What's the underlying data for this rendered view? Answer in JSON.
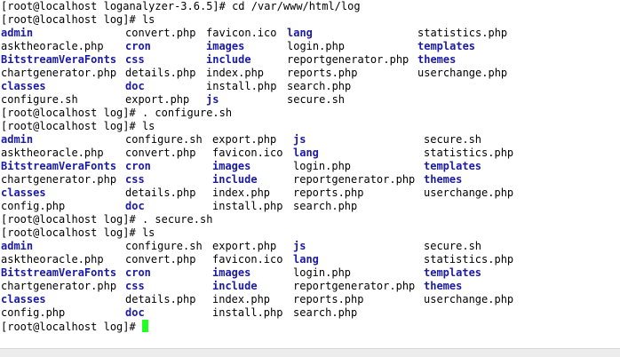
{
  "colors": {
    "background": "#ffffff",
    "text": "#000000",
    "directory": "#1a1aa6",
    "cursor": "#22ff22"
  },
  "lines": {
    "l0": "[root@localhost loganalyzer-3.6.5]# cd /var/www/html/log",
    "l1": "[root@localhost log]# ls",
    "l7": "[root@localhost log]# . configure.sh",
    "l8": "[root@localhost log]# ls",
    "l14": "[root@localhost log]# . secure.sh",
    "l15": "[root@localhost log]# ls",
    "l21": "[root@localhost log]# "
  },
  "ls1": {
    "r1": [
      "admin",
      "convert.php",
      "favicon.ico",
      "lang",
      "statistics.php"
    ],
    "r2": [
      "asktheoracle.php",
      "cron",
      "images",
      "login.php",
      "templates"
    ],
    "r3": [
      "BitstreamVeraFonts",
      "css",
      "include",
      "reportgenerator.php",
      "themes"
    ],
    "r4": [
      "chartgenerator.php",
      "details.php",
      "index.php",
      "reports.php",
      "userchange.php"
    ],
    "r5": [
      "classes",
      "doc",
      "install.php",
      "search.php",
      ""
    ],
    "r6": [
      "configure.sh",
      "export.php",
      "js",
      "secure.sh",
      ""
    ]
  },
  "ls2": {
    "r1": [
      "admin",
      "configure.sh",
      "export.php",
      "js",
      "secure.sh"
    ],
    "r2": [
      "asktheoracle.php",
      "convert.php",
      "favicon.ico",
      "lang",
      "statistics.php"
    ],
    "r3": [
      "BitstreamVeraFonts",
      "cron",
      "images",
      "login.php",
      "templates"
    ],
    "r4": [
      "chartgenerator.php",
      "css",
      "include",
      "reportgenerator.php",
      "themes"
    ],
    "r5": [
      "classes",
      "details.php",
      "index.php",
      "reports.php",
      "userchange.php"
    ],
    "r6": [
      "config.php",
      "doc",
      "install.php",
      "search.php",
      ""
    ]
  },
  "ls3": {
    "r1": [
      "admin",
      "configure.sh",
      "export.php",
      "js",
      "secure.sh"
    ],
    "r2": [
      "asktheoracle.php",
      "convert.php",
      "favicon.ico",
      "lang",
      "statistics.php"
    ],
    "r3": [
      "BitstreamVeraFonts",
      "cron",
      "images",
      "login.php",
      "templates"
    ],
    "r4": [
      "chartgenerator.php",
      "css",
      "include",
      "reportgenerator.php",
      "themes"
    ],
    "r5": [
      "classes",
      "details.php",
      "index.php",
      "reports.php",
      "userchange.php"
    ],
    "r6": [
      "config.php",
      "doc",
      "install.php",
      "search.php",
      ""
    ]
  }
}
